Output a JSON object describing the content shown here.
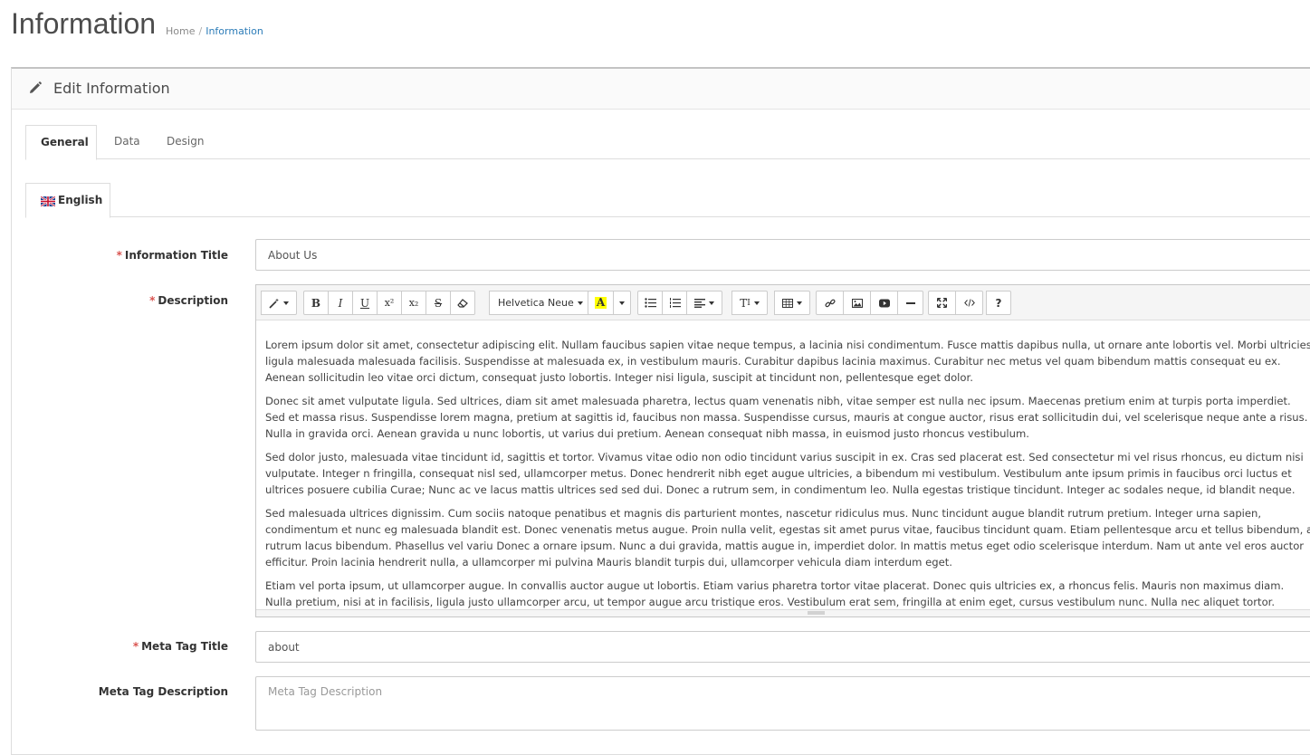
{
  "header": {
    "title": "Information",
    "breadcrumb": [
      {
        "label": "Home"
      },
      {
        "label": "Information"
      }
    ],
    "breadcrumb_separator": "/"
  },
  "panel": {
    "title": "Edit Information",
    "icon": "pencil-icon"
  },
  "tabs": [
    {
      "label": "General",
      "active": true
    },
    {
      "label": "Data",
      "active": false
    },
    {
      "label": "Design",
      "active": false
    }
  ],
  "language_tab": {
    "label": "English",
    "flag_icon": "uk-flag-icon"
  },
  "form": {
    "title_label": "Information Title",
    "title_value": "About Us",
    "description_label": "Description",
    "meta_title_label": "Meta Tag Title",
    "meta_title_value": "about",
    "meta_description_label": "Meta Tag Description",
    "meta_description_placeholder": "Meta Tag Description",
    "required_marker": "*"
  },
  "toolbar": {
    "font_name": "Helvetica Neue",
    "superscript": "x²",
    "subscript": "x₂",
    "text_size": "T",
    "help": "?",
    "highlight_color": "#ffff00"
  },
  "description_paragraphs": [
    "Lorem ipsum dolor sit amet, consectetur adipiscing elit. Nullam faucibus sapien vitae neque tempus, a lacinia nisi condimentum. Fusce mattis dapibus nulla, ut ornare ante lobortis vel. Morbi ultricies ligula malesuada malesuada facilisis. Suspendisse at malesuada ex, in vestibulum mauris. Curabitur dapibus lacinia maximus. Curabitur nec metus vel quam bibendum mattis consequat eu ex. Aenean sollicitudin leo vitae orci dictum, consequat justo lobortis. Integer nisi ligula, suscipit at tincidunt non, pellentesque eget dolor.",
    "Donec sit amet vulputate ligula. Sed ultrices, diam sit amet malesuada pharetra, lectus quam venenatis nibh, vitae semper est nulla nec ipsum. Maecenas pretium enim at turpis porta imperdiet. Sed et massa risus. Suspendisse lorem magna, pretium at sagittis id, faucibus non massa. Suspendisse cursus, mauris at congue auctor, risus erat sollicitudin dui, vel scelerisque neque ante a risus. Nulla in gravida orci. Aenean gravida u nunc lobortis, ut varius dui pretium. Aenean consequat nibh massa, in euismod justo rhoncus vestibulum.",
    "Sed dolor justo, malesuada vitae tincidunt id, sagittis et tortor. Vivamus vitae odio non odio tincidunt varius suscipit in ex. Cras sed placerat est. Sed consectetur mi vel risus rhoncus, eu dictum nisi vulputate. Integer n fringilla, consequat nisl sed, ullamcorper metus. Donec hendrerit nibh eget augue ultricies, a bibendum mi vestibulum. Vestibulum ante ipsum primis in faucibus orci luctus et ultrices posuere cubilia Curae; Nunc ac ve lacus mattis ultrices sed sed dui. Donec a rutrum sem, in condimentum leo. Nulla egestas tristique tincidunt. Integer ac sodales neque, id blandit neque.",
    "Sed malesuada ultrices dignissim. Cum sociis natoque penatibus et magnis dis parturient montes, nascetur ridiculus mus. Nunc tincidunt augue blandit rutrum pretium. Integer urna sapien, condimentum et nunc eg malesuada blandit est. Donec venenatis metus augue. Proin nulla velit, egestas sit amet purus vitae, faucibus tincidunt quam. Etiam pellentesque arcu et tellus bibendum, a rutrum lacus bibendum. Phasellus vel variu Donec a ornare ipsum. Nunc a dui gravida, mattis augue in, imperdiet dolor. In mattis metus eget odio scelerisque interdum. Nam ut ante vel eros auctor efficitur. Proin lacinia hendrerit nulla, a ullamcorper mi pulvina Mauris blandit turpis dui, ullamcorper vehicula diam interdum eget.",
    "Etiam vel porta ipsum, ut ullamcorper augue. In convallis auctor augue ut lobortis. Etiam varius pharetra tortor vitae placerat. Donec quis ultricies ex, a rhoncus felis. Mauris non maximus diam. Nulla pretium, nisi at in facilisis, ligula justo ullamcorper arcu, ut tempor augue arcu tristique eros. Vestibulum erat sem, fringilla at enim eget, cursus vestibulum nunc. Nulla nec aliquet tortor. Praesent pellentesque quis dui ut porttitor. Ut vi"
  ],
  "colors": {
    "accent_link": "#2c7cb8",
    "required": "#d9534f",
    "heading_text": "#4c4c4c"
  }
}
